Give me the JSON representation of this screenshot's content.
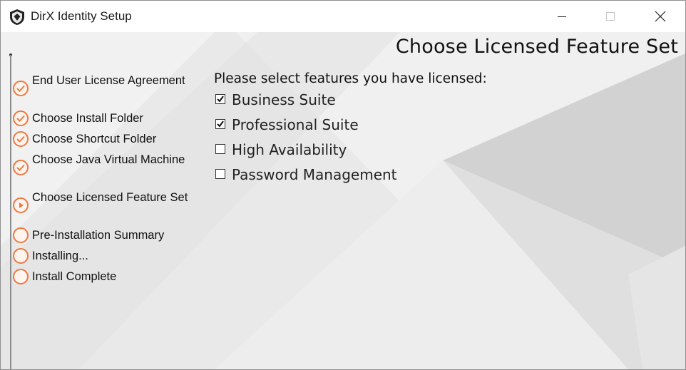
{
  "window": {
    "title": "DirX Identity Setup",
    "icon": "shield-app-icon"
  },
  "header": {
    "title": "Choose Licensed Feature Set"
  },
  "steps": [
    {
      "label": "End User License Agreement",
      "status": "done"
    },
    {
      "label": "Choose Install Folder",
      "status": "done"
    },
    {
      "label": "Choose Shortcut Folder",
      "status": "done"
    },
    {
      "label": "Choose Java Virtual Machine",
      "status": "done"
    },
    {
      "label": "Choose Licensed Feature Set",
      "status": "current"
    },
    {
      "label": "Pre-Installation Summary",
      "status": "pending"
    },
    {
      "label": "Installing...",
      "status": "pending"
    },
    {
      "label": "Install Complete",
      "status": "pending"
    }
  ],
  "main": {
    "prompt": "Please select features you have licensed:",
    "features": [
      {
        "label": "Business Suite",
        "checked": true
      },
      {
        "label": "Professional Suite",
        "checked": true
      },
      {
        "label": "High Availability",
        "checked": false
      },
      {
        "label": "Password Management",
        "checked": false
      }
    ]
  },
  "colors": {
    "accent": "#f07840",
    "background": "#e9e9e9"
  }
}
